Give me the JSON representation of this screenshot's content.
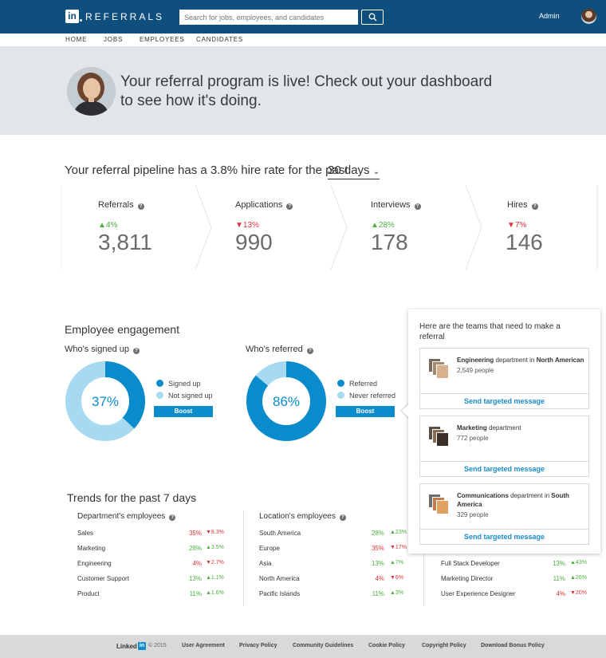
{
  "header": {
    "logo_mark": "in",
    "brand": "REFERRALS",
    "search_placeholder": "Search for jobs, employees, and candidates",
    "user_label": "Admin"
  },
  "nav": {
    "items": [
      "HOME",
      "JOBS",
      "EMPLOYEES",
      "CANDIDATES"
    ]
  },
  "hero": {
    "message": "Your referral program is live! Check out your dashboard to see how it's doing."
  },
  "pipeline": {
    "title_prefix": "Your referral pipeline has a 3.8% hire rate for the past",
    "range": "30 days",
    "metrics": [
      {
        "label": "Referrals",
        "change": "▲4%",
        "direction": "up",
        "value": "3,811"
      },
      {
        "label": "Applications",
        "change": "▼13%",
        "direction": "down",
        "value": "990"
      },
      {
        "label": "Interviews",
        "change": "▲28%",
        "direction": "up",
        "value": "178"
      },
      {
        "label": "Hires",
        "change": "▼7%",
        "direction": "down",
        "value": "146"
      }
    ]
  },
  "engagement": {
    "title": "Employee engagement",
    "signed_up": {
      "title": "Who's signed up",
      "percent_label": "37%",
      "fraction": 0.37,
      "legend": [
        "Signed up",
        "Not signed up"
      ],
      "boost": "Boost"
    },
    "referred": {
      "title": "Who's referred",
      "percent_label": "86%",
      "fraction": 0.86,
      "legend": [
        "Referred",
        "Never referred"
      ],
      "boost": "Boost"
    },
    "colors": {
      "primary": "#0a8ccc",
      "secondary": "#a7daf0"
    }
  },
  "teams_panel": {
    "title": "Here are the teams that need to make a referral",
    "teams": [
      {
        "name": "Engineering",
        "suffix": " department in ",
        "place": "North American",
        "count": "2,549 people",
        "action": "Send targeted message"
      },
      {
        "name": "Marketing",
        "suffix": " department",
        "place": "",
        "count": "772 people",
        "action": "Send targeted message"
      },
      {
        "name": "Communications",
        "suffix": " department in ",
        "place": "South America",
        "count": "329 people",
        "action": "Send targeted message"
      }
    ]
  },
  "trends": {
    "title": "Trends for the past 7 days",
    "departments": {
      "header": "Department's employees",
      "rows": [
        {
          "name": "Sales",
          "value": "35%",
          "change": "▼8.3%",
          "direction": "down",
          "value_color": "red"
        },
        {
          "name": "Marketing",
          "value": "28%",
          "change": "▲3.5%",
          "direction": "up",
          "value_color": "green"
        },
        {
          "name": "Engineering",
          "value": "4%",
          "change": "▼2.7%",
          "direction": "down",
          "value_color": "red"
        },
        {
          "name": "Customer Support",
          "value": "13%",
          "change": "▲1.1%",
          "direction": "up",
          "value_color": "green"
        },
        {
          "name": "Product",
          "value": "11%",
          "change": "▲1.6%",
          "direction": "up",
          "value_color": "green"
        }
      ]
    },
    "locations": {
      "header": "Location's employees",
      "rows": [
        {
          "name": "South America",
          "value": "28%",
          "change": "▲23%",
          "direction": "up",
          "value_color": "green"
        },
        {
          "name": "Europe",
          "value": "35%",
          "change": "▼17%",
          "direction": "down",
          "value_color": "red"
        },
        {
          "name": "Asia",
          "value": "13%",
          "change": "▲7%",
          "direction": "up",
          "value_color": "green"
        },
        {
          "name": "North America",
          "value": "4%",
          "change": "▼6%",
          "direction": "down",
          "value_color": "red"
        },
        {
          "name": "Pacific Islands",
          "value": "11%",
          "change": "▲3%",
          "direction": "up",
          "value_color": "green"
        }
      ]
    },
    "roles": {
      "rows": [
        {
          "name": "Full Stack Developer",
          "value": "13%",
          "change": "▲43%",
          "direction": "up",
          "value_color": "green"
        },
        {
          "name": "Marketing Director",
          "value": "11%",
          "change": "▲26%",
          "direction": "up",
          "value_color": "green"
        },
        {
          "name": "User Experience Designer",
          "value": "4%",
          "change": "▼20%",
          "direction": "down",
          "value_color": "red"
        }
      ]
    }
  },
  "footer": {
    "brand": "Linked",
    "brand_mark": "in",
    "copyright": "© 2015",
    "links": [
      "User Agreement",
      "Privacy Policy",
      "Community Guidelines",
      "Cookie Policy",
      "Copyright Policy",
      "Download Bonus Policy"
    ]
  }
}
